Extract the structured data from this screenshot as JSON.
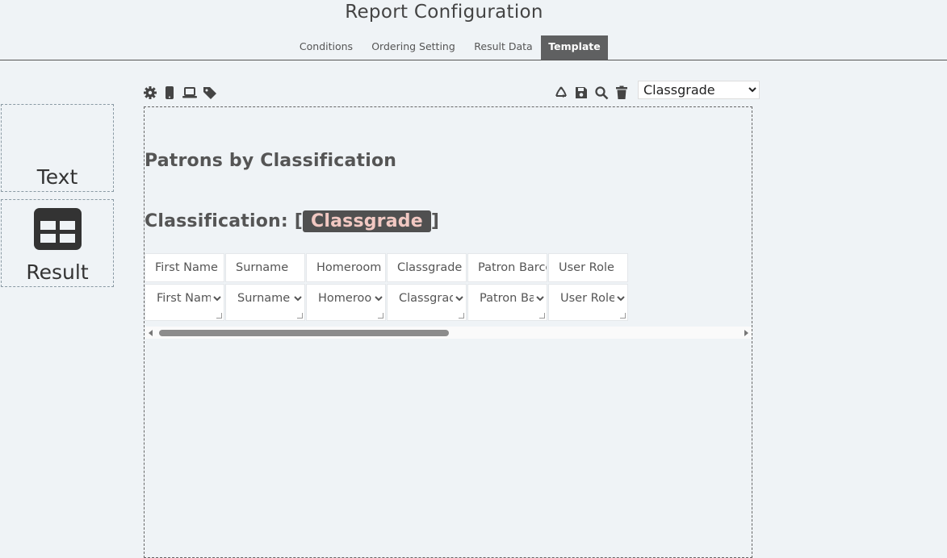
{
  "header": {
    "title": "Report Configuration"
  },
  "tabs": [
    {
      "label": "Conditions",
      "active": false
    },
    {
      "label": "Ordering Setting",
      "active": false
    },
    {
      "label": "Result Data",
      "active": false
    },
    {
      "label": "Template",
      "active": true
    }
  ],
  "widgets": {
    "text_label": "Text",
    "result_label": "Result"
  },
  "toolbar": {
    "left_icons": [
      "gear-icon",
      "mobile-icon",
      "laptop-icon",
      "tag-icon"
    ],
    "right_icons": [
      "recycle-icon",
      "save-icon",
      "search-icon",
      "trash-icon"
    ],
    "group_select": {
      "value": "Classgrade",
      "options": [
        "Classgrade"
      ]
    }
  },
  "template": {
    "heading": "Patrons by Classification",
    "classification_label": "Classification: [",
    "classification_value": "Classgrade",
    "classification_close": "]",
    "columns": [
      {
        "header": "First Name",
        "field": "First Name"
      },
      {
        "header": "Surname",
        "field": "Surname"
      },
      {
        "header": "Homeroom",
        "field": "Homeroom"
      },
      {
        "header": "Classgrade",
        "field": "Classgrade"
      },
      {
        "header": "Patron Barcode",
        "field": "Patron Barcode"
      },
      {
        "header": "User Role",
        "field": "User Role"
      }
    ]
  },
  "colors": {
    "active_tab": "#5f6061",
    "accent_pill": "#505050",
    "pill_text": "#f1c8c2",
    "background": "#eff3f6"
  }
}
